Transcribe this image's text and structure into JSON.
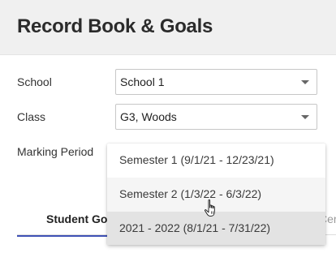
{
  "header": {
    "title": "Record Book & Goals"
  },
  "form": {
    "school": {
      "label": "School",
      "value": "School 1"
    },
    "class": {
      "label": "Class",
      "value": "G3, Woods"
    },
    "marking_period": {
      "label": "Marking Period"
    }
  },
  "dropdown": {
    "options": [
      {
        "label": "Semester 1 (9/1/21 - 12/23/21)"
      },
      {
        "label": "Semester 2 (1/3/22 - 6/3/22)"
      },
      {
        "label": "2021 - 2022 (8/1/21 - 7/31/22)"
      }
    ],
    "hovered_index": 1,
    "selected_index": 2
  },
  "tabs": {
    "active_label": "Student Goals",
    "right_label": "Certif"
  },
  "icons": {
    "caret": "chevron-down-icon",
    "cursor": "hand-pointer-icon"
  },
  "colors": {
    "header_bg": "#f0f0f0",
    "tab_underline": "#3f51b5",
    "option_hover": "#f5f5f5",
    "option_selected": "#e3e3e3"
  }
}
